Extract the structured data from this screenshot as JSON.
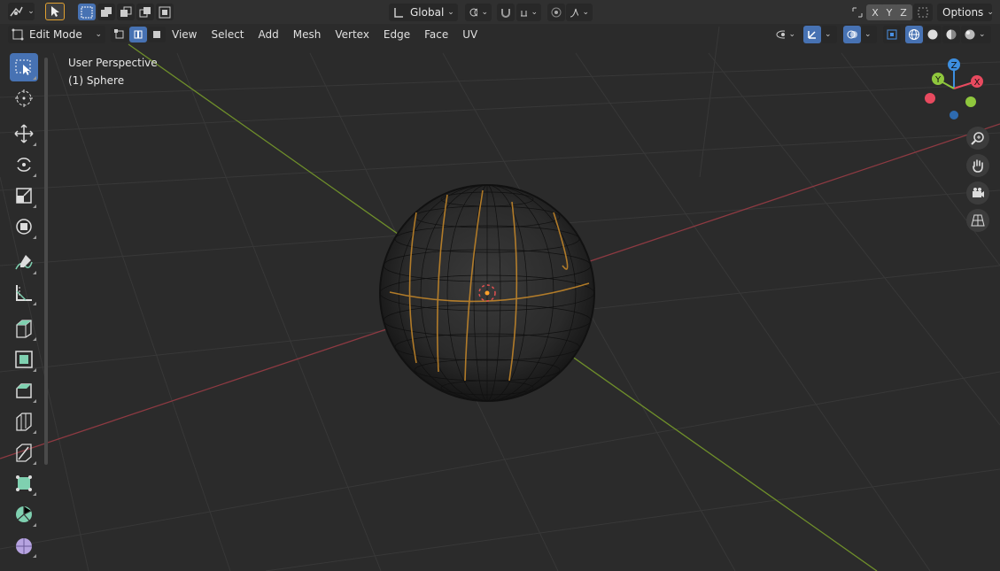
{
  "header": {
    "transform_orientation": "Global",
    "axes": [
      "X",
      "Y",
      "Z"
    ],
    "options_label": "Options"
  },
  "header2": {
    "mode": "Edit Mode",
    "menus": [
      "View",
      "Select",
      "Add",
      "Mesh",
      "Vertex",
      "Edge",
      "Face",
      "UV"
    ]
  },
  "viewport": {
    "perspective_label": "User Perspective",
    "object_label": "(1) Sphere"
  },
  "gizmo": {
    "x_label": "X",
    "y_label": "Y",
    "z_label": "Z",
    "colors": {
      "x": "#e84a5f",
      "y": "#8fc73d",
      "z": "#3d8fe0"
    }
  },
  "colors": {
    "accent": "#4772b3",
    "x_axis": "#9c3a43",
    "y_axis": "#6b8e23",
    "selection": "#ffa12a"
  },
  "tools": [
    "select-box-icon",
    "cursor-icon",
    "move-icon",
    "rotate-icon",
    "scale-icon",
    "transform-icon",
    "annotate-icon",
    "measure-icon",
    "extrude-icon",
    "inset-icon",
    "bevel-icon",
    "loop-cut-icon",
    "knife-icon",
    "poly-build-icon",
    "spin-icon",
    "smooth-icon"
  ]
}
